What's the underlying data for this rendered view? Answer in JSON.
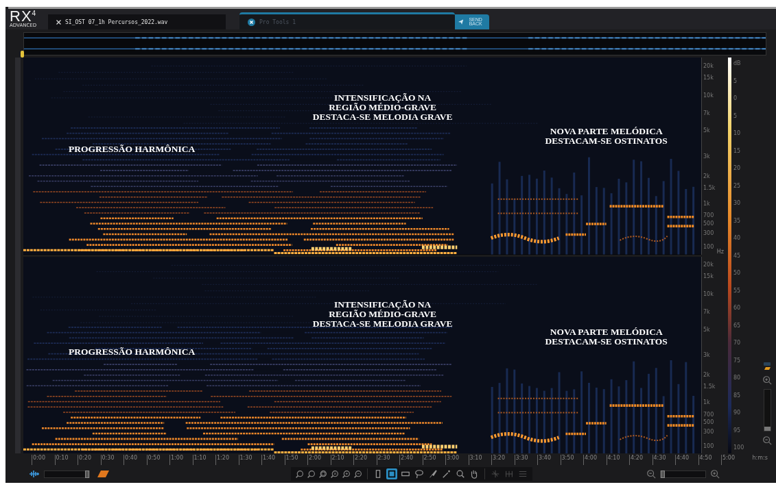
{
  "logo": {
    "name": "RX",
    "version": "4",
    "edition": "ADVANCED"
  },
  "tabs": [
    {
      "kind": "file",
      "label": "SI_OST 07_1h Percursos_2022.wav",
      "selected": true
    },
    {
      "kind": "host",
      "label": "Pro Tools 1",
      "selected": false
    }
  ],
  "send_back": "SEND BACK",
  "channels": [
    {
      "annotations": [
        {
          "lines": [
            "PROGRESSÃO HARMÔNICA"
          ]
        },
        {
          "lines": [
            "INTENSIFICAÇÃO NA",
            "REGIÃO MÉDIO-GRAVE",
            "DESTACA-SE MELODIA GRAVE"
          ]
        },
        {
          "lines": [
            "NOVA PARTE MELÓDICA",
            "DESTACAM-SE OSTINATOS"
          ]
        }
      ],
      "freq_labels": [
        "20k",
        "15k",
        "10k",
        "7k",
        "5k",
        "3k",
        "2k",
        "1.5k",
        "1k",
        "700",
        "500",
        "300",
        "100"
      ],
      "unit": "Hz"
    },
    {
      "annotations": [
        {
          "lines": [
            "PROGRESSÃO HARMÔNICA"
          ]
        },
        {
          "lines": [
            "INTENSIFICAÇÃO NA",
            "REGIÃO MÉDIO-GRAVE",
            "DESTACA-SE MELODIA GRAVE"
          ]
        },
        {
          "lines": [
            "NOVA PARTE MELÓDICA",
            "DESTACAM-SE OSTINATOS"
          ]
        }
      ],
      "freq_labels": [
        "20k",
        "15k",
        "10k",
        "7k",
        "5k",
        "3k",
        "2k",
        "1.5k",
        "1k",
        "700",
        "500",
        "300",
        "100"
      ]
    }
  ],
  "db_scale": [
    "dB",
    "5",
    "0",
    "5",
    "10",
    "15",
    "20",
    "25",
    "30",
    "35",
    "40",
    "45",
    "50",
    "55",
    "60",
    "65",
    "70",
    "75",
    "80",
    "85",
    "90",
    "95",
    "100"
  ],
  "time_ruler": {
    "labels": [
      "0:00",
      "0:10",
      "0:20",
      "0:30",
      "0:40",
      "0:50",
      "1:00",
      "1:10",
      "1:20",
      "1:30",
      "1:40",
      "1:50",
      "2:00",
      "2:10",
      "2:20",
      "2:30",
      "2:40",
      "2:50",
      "3:00",
      "3:10",
      "3:20",
      "3:30",
      "3:40",
      "3:50",
      "4:00",
      "4:10",
      "4:20",
      "4:30",
      "4:40",
      "4:50",
      "5:00"
    ],
    "unit": "h:m:s"
  },
  "blend_slider": {
    "level": 1
  },
  "tools": [
    {
      "kind": "time",
      "selected": false,
      "disabled": false
    },
    {
      "kind": "box",
      "selected": true,
      "disabled": false
    },
    {
      "kind": "frequency",
      "selected": false,
      "disabled": false
    },
    {
      "kind": "lasso",
      "selected": false,
      "disabled": false
    },
    {
      "kind": "brush",
      "selected": false,
      "disabled": false
    },
    {
      "kind": "wand",
      "selected": false,
      "disabled": false
    },
    {
      "kind": "zoom",
      "selected": false,
      "disabled": false
    },
    {
      "kind": "hand",
      "selected": false,
      "disabled": false
    },
    {
      "kind": "sparkle",
      "selected": false,
      "disabled": true
    },
    {
      "kind": "harmonic",
      "selected": false,
      "disabled": true
    },
    {
      "kind": "list",
      "selected": false,
      "disabled": true
    }
  ],
  "zoom_slider": {
    "level": 0
  },
  "vertical_zoom": {
    "level": 0
  }
}
